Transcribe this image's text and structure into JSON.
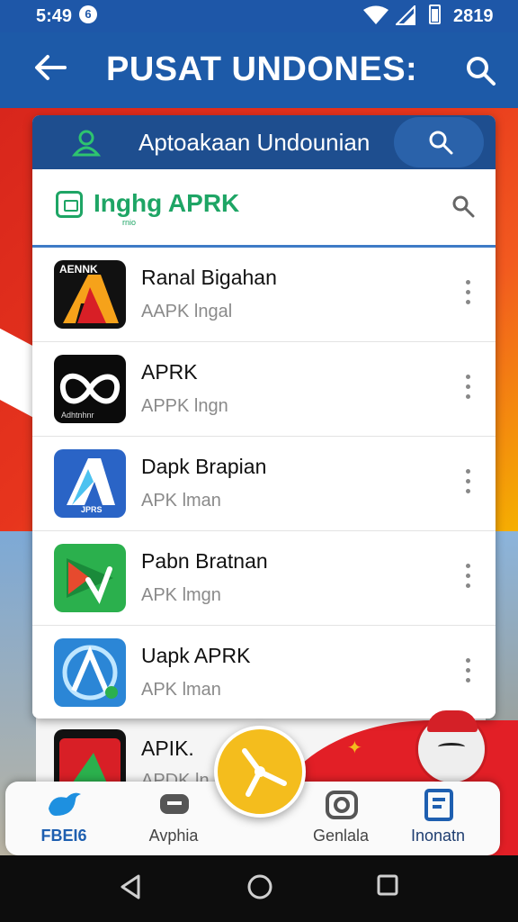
{
  "status_bar": {
    "time": "5:49",
    "notification_badge": "6",
    "battery_pct": "2819"
  },
  "app_bar": {
    "title": "PUSAT UNDONES:"
  },
  "card": {
    "header_label": "Aptoakaan Undounian",
    "search_text": "Inghg APRK",
    "search_subtext": "rnio"
  },
  "apps": [
    {
      "name": "Ranal Bigahan",
      "subtitle": "AAPK lngal",
      "icon": "red-A-badge-icon",
      "icon_text": "AENNK"
    },
    {
      "name": "APRK",
      "subtitle": "APPK lngn",
      "icon": "infinity-badge-icon",
      "icon_text": "Adhtnhnr"
    },
    {
      "name": "Dapk Brapian",
      "subtitle": "APK lman",
      "icon": "blue-A-badge-icon",
      "icon_text": "JPRS"
    },
    {
      "name": "Pabn Bratnan",
      "subtitle": "APK lmgn",
      "icon": "green-play-icon",
      "icon_text": ""
    },
    {
      "name": "Uapk APRK",
      "subtitle": "APK lman",
      "icon": "compass-A-icon",
      "icon_text": ""
    }
  ],
  "peek_item": {
    "name": "APIK.",
    "subtitle": "APDK ln"
  },
  "bottom_nav": [
    {
      "label": "FBEI6",
      "icon": "bird-icon"
    },
    {
      "label": "Avphia",
      "icon": "chat-icon"
    },
    {
      "label": "Genlala",
      "icon": "camera-icon"
    },
    {
      "label": "Inonatn",
      "icon": "document-icon"
    }
  ],
  "colors": {
    "primary": "#1d5aa8",
    "accent_green": "#1ea565",
    "fab": "#f4bd1d",
    "red": "#e21f26"
  }
}
